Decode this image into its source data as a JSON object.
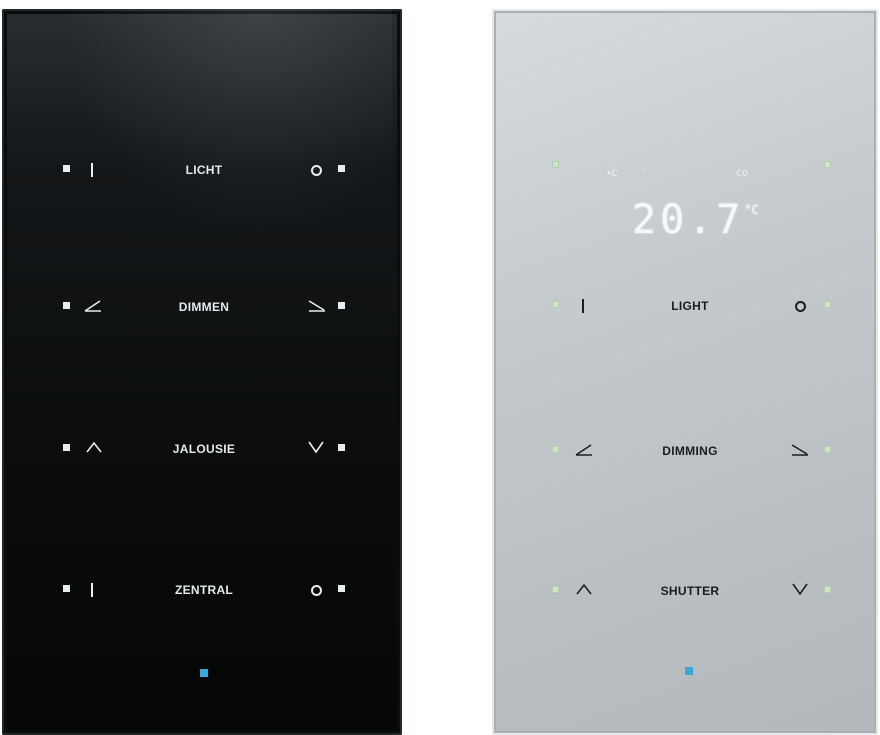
{
  "panel_black": {
    "rows": [
      {
        "label": "LICHT",
        "left_symbol": "bar",
        "right_symbol": "circle"
      },
      {
        "label": "DIMMEN",
        "left_symbol": "dim-up",
        "right_symbol": "dim-down"
      },
      {
        "label": "JALOUSIE",
        "left_symbol": "caret-up",
        "right_symbol": "caret-down"
      },
      {
        "label": "ZENTRAL",
        "left_symbol": "bar",
        "right_symbol": "circle"
      }
    ]
  },
  "panel_silver": {
    "display": {
      "temperature": "20.7",
      "unit": "°C",
      "indicator_left": "•C",
      "indicator_mid": "'",
      "indicator_right": "ℂ0"
    },
    "rows": [
      {
        "label": "LIGHT",
        "left_symbol": "bar",
        "right_symbol": "circle"
      },
      {
        "label": "DIMMING",
        "left_symbol": "dim-up",
        "right_symbol": "dim-down"
      },
      {
        "label": "SHUTTER",
        "left_symbol": "caret-up",
        "right_symbol": "caret-down"
      }
    ]
  },
  "colors": {
    "status_led": "#3aa7d9",
    "led_dark": "#e8ecee",
    "led_light": "#cfe4c9"
  }
}
